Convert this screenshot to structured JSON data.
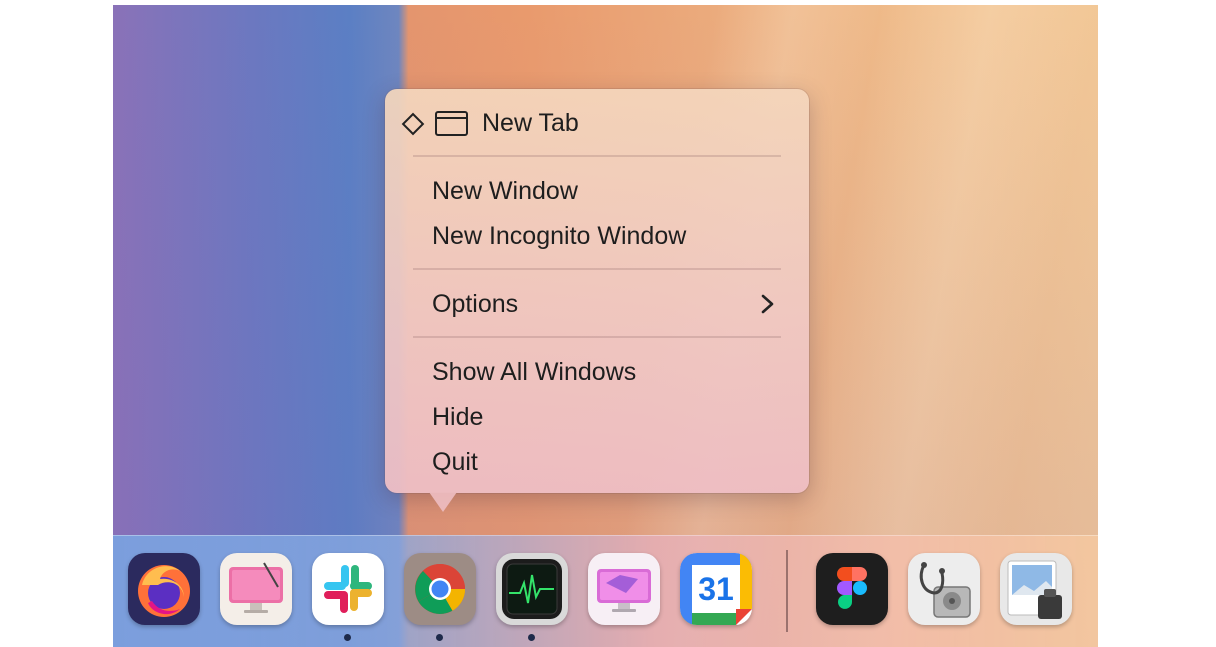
{
  "context_menu": {
    "items": [
      {
        "label": "New Tab"
      },
      {
        "label": "New Window"
      },
      {
        "label": "New Incognito Window"
      },
      {
        "label": "Options"
      },
      {
        "label": "Show All Windows"
      },
      {
        "label": "Hide"
      },
      {
        "label": "Quit"
      }
    ]
  },
  "dock": {
    "apps": [
      {
        "icon": "firefox-icon",
        "running": false
      },
      {
        "icon": "cleanmymac-icon",
        "running": false
      },
      {
        "icon": "slack-icon",
        "running": true
      },
      {
        "icon": "chrome-icon",
        "running": true
      },
      {
        "icon": "activity-monitor-icon",
        "running": true
      },
      {
        "icon": "cleanmymac-x-icon",
        "running": false
      },
      {
        "icon": "google-calendar-icon",
        "running": false,
        "label": "31"
      },
      {
        "icon": "figma-icon",
        "running": false
      },
      {
        "icon": "disk-utility-icon",
        "running": false
      },
      {
        "icon": "preview-icon",
        "running": false
      }
    ]
  },
  "colors": {
    "menu_text": "#1e1e1e",
    "running_dot": "#1e2a4a",
    "calendar_blue": "#1a73e8"
  }
}
